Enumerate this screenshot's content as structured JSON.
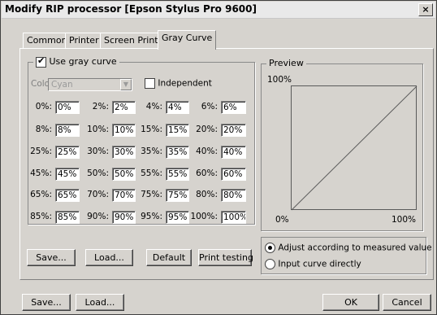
{
  "window": {
    "title": "Modify RIP processor [Epson Stylus Pro 9600]",
    "close_glyph": "×"
  },
  "tabs": [
    {
      "label": "Common",
      "active": false
    },
    {
      "label": "Printer",
      "active": false
    },
    {
      "label": "Screen Print",
      "active": false
    },
    {
      "label": "Gray Curve",
      "active": true
    }
  ],
  "gray_curve": {
    "use_label": "Use gray curve",
    "use_checked": true,
    "color_label": "Color:",
    "color_value": "Cyan",
    "independent_label": "Independent",
    "independent_checked": false,
    "rows": [
      [
        {
          "label": "0%:",
          "value": "0%"
        },
        {
          "label": "2%:",
          "value": "2%"
        },
        {
          "label": "4%:",
          "value": "4%"
        },
        {
          "label": "6%:",
          "value": "6%"
        }
      ],
      [
        {
          "label": "8%:",
          "value": "8%"
        },
        {
          "label": "10%:",
          "value": "10%"
        },
        {
          "label": "15%:",
          "value": "15%"
        },
        {
          "label": "20%:",
          "value": "20%"
        }
      ],
      [
        {
          "label": "25%:",
          "value": "25%"
        },
        {
          "label": "30%:",
          "value": "30%"
        },
        {
          "label": "35%:",
          "value": "35%"
        },
        {
          "label": "40%:",
          "value": "40%"
        }
      ],
      [
        {
          "label": "45%:",
          "value": "45%"
        },
        {
          "label": "50%:",
          "value": "50%"
        },
        {
          "label": "55%:",
          "value": "55%"
        },
        {
          "label": "60%:",
          "value": "60%"
        }
      ],
      [
        {
          "label": "65%:",
          "value": "65%"
        },
        {
          "label": "70%:",
          "value": "70%"
        },
        {
          "label": "75%:",
          "value": "75%"
        },
        {
          "label": "80%:",
          "value": "80%"
        }
      ],
      [
        {
          "label": "85%:",
          "value": "85%"
        },
        {
          "label": "90%:",
          "value": "90%"
        },
        {
          "label": "95%:",
          "value": "95%"
        },
        {
          "label": "100%:",
          "value": "100%"
        }
      ]
    ],
    "buttons": {
      "save": "Save...",
      "load": "Load...",
      "default": "Default",
      "print_testing": "Print testing"
    }
  },
  "preview": {
    "label": "Preview",
    "y_max_label": "100%",
    "x_min_label": "0%",
    "x_max_label": "100%"
  },
  "mode": {
    "options": [
      {
        "label": "Adjust according to measured value",
        "selected": true
      },
      {
        "label": "Input curve directly",
        "selected": false
      }
    ]
  },
  "footer": {
    "save": "Save...",
    "load": "Load...",
    "ok": "OK",
    "cancel": "Cancel"
  }
}
